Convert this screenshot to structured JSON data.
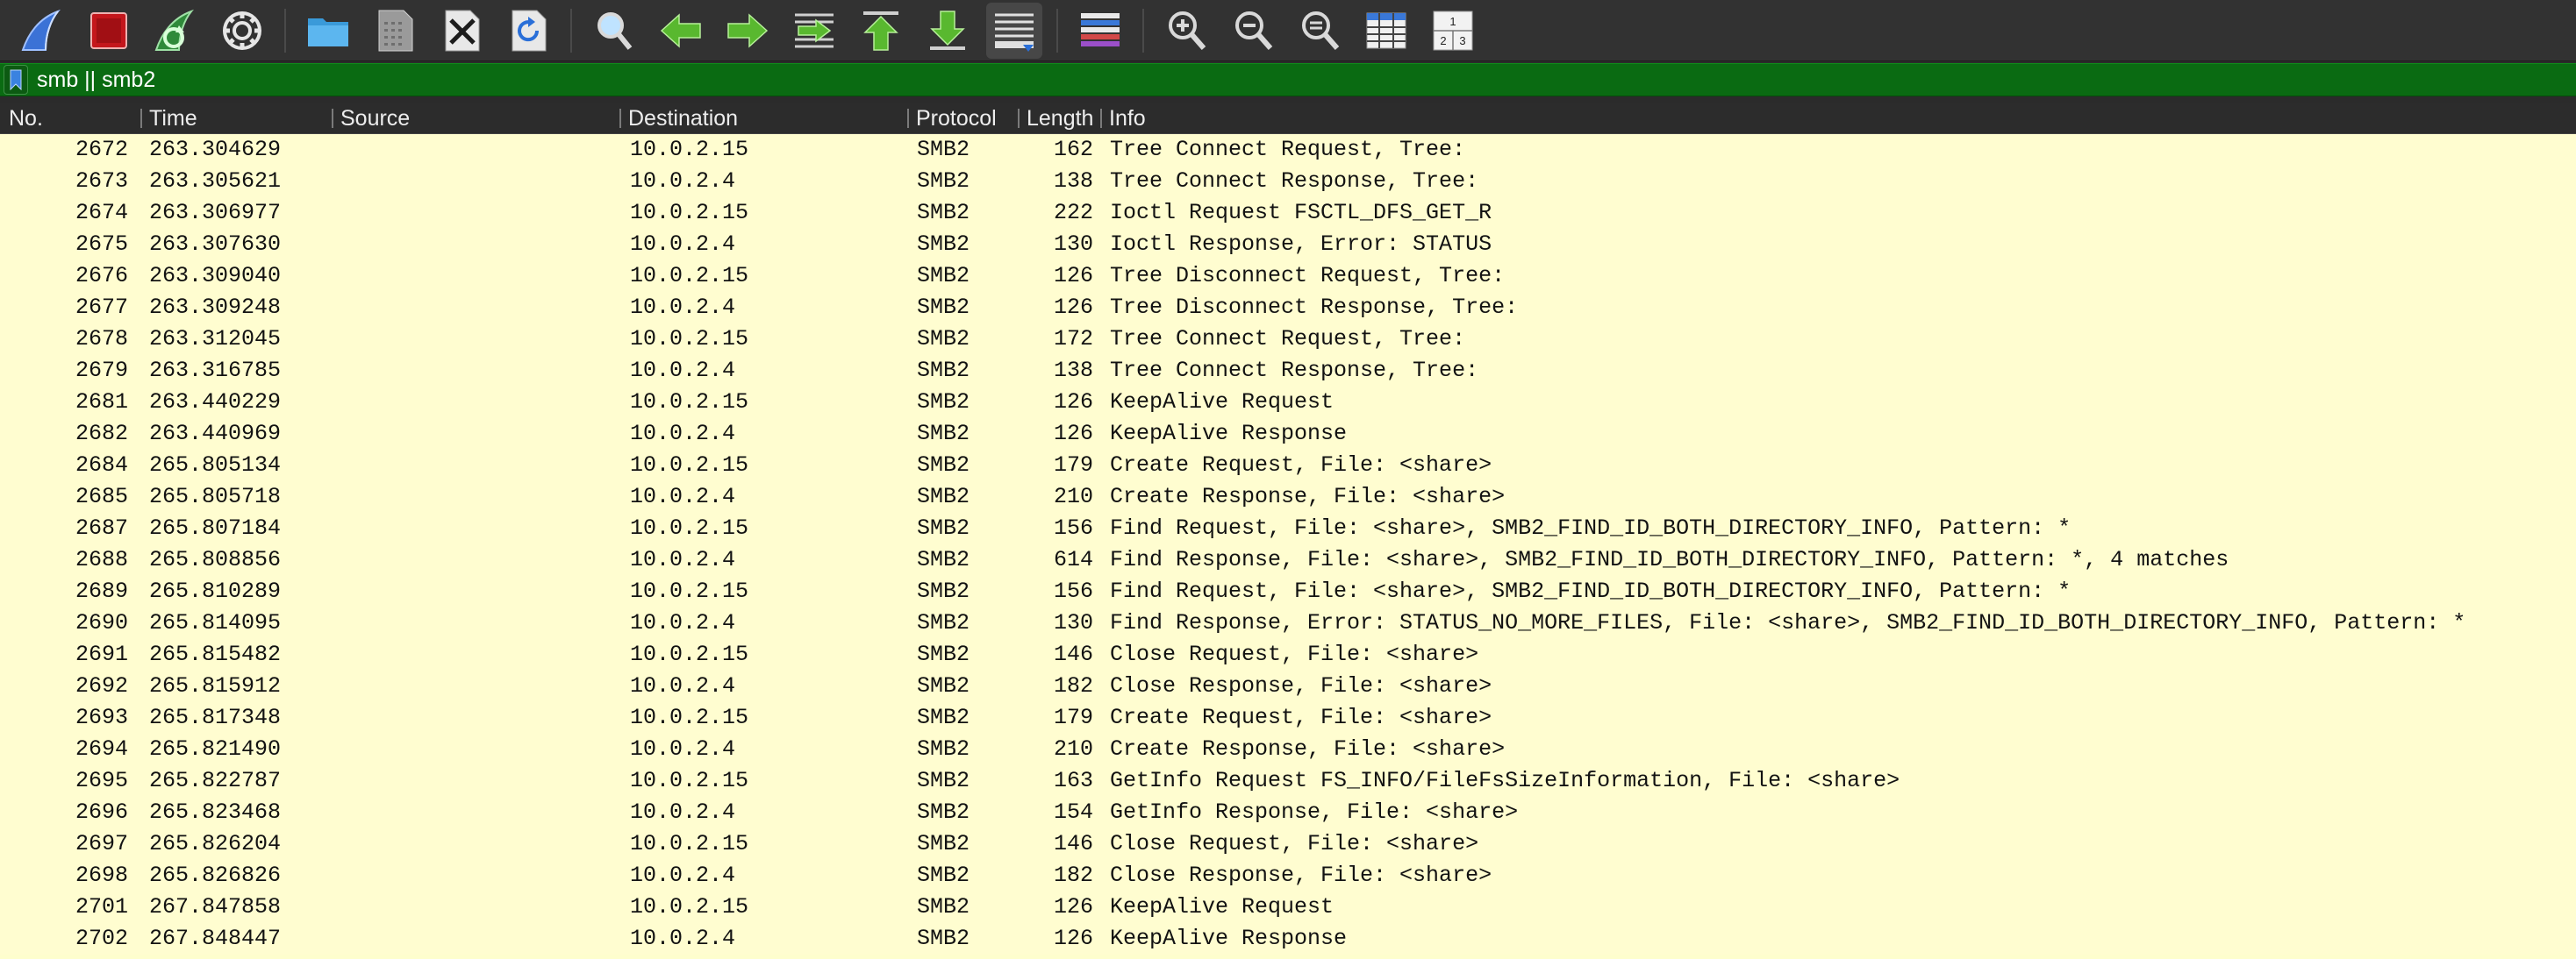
{
  "toolbar": {
    "buttons": [
      {
        "name": "start-capture-icon"
      },
      {
        "name": "stop-capture-icon"
      },
      {
        "name": "restart-capture-icon"
      },
      {
        "name": "capture-options-icon"
      },
      {
        "name": "open-file-icon"
      },
      {
        "name": "save-file-icon"
      },
      {
        "name": "close-file-icon"
      },
      {
        "name": "reload-file-icon"
      },
      {
        "name": "find-packet-icon"
      },
      {
        "name": "go-back-icon"
      },
      {
        "name": "go-forward-icon"
      },
      {
        "name": "go-to-packet-icon"
      },
      {
        "name": "go-first-packet-icon"
      },
      {
        "name": "go-last-packet-icon"
      },
      {
        "name": "auto-scroll-icon"
      },
      {
        "name": "colorize-icon"
      },
      {
        "name": "zoom-in-icon"
      },
      {
        "name": "zoom-out-icon"
      },
      {
        "name": "normal-size-icon"
      },
      {
        "name": "resize-columns-icon"
      },
      {
        "name": "layout-icon"
      }
    ],
    "layout_icon_digits": [
      "1",
      "2",
      "3"
    ]
  },
  "filter": {
    "value": "smb || smb2",
    "bookmark_icon": "bookmark-icon",
    "background_color": "#0a6b12"
  },
  "columns": {
    "no": "No.",
    "time": "Time",
    "source": "Source",
    "destination": "Destination",
    "protocol": "Protocol",
    "length": "Length",
    "info": "Info"
  },
  "colors": {
    "row_background": "#fffdd0",
    "header_background": "#2c2c2c"
  },
  "packets": [
    {
      "no": "2672",
      "time": "263.304629",
      "source": "",
      "destination": "10.0.2.15",
      "protocol": "SMB2",
      "length": "162",
      "info": "Tree Connect Request, Tree:"
    },
    {
      "no": "2673",
      "time": "263.305621",
      "source": "",
      "destination": "10.0.2.4",
      "protocol": "SMB2",
      "length": "138",
      "info": "Tree Connect Response, Tree:"
    },
    {
      "no": "2674",
      "time": "263.306977",
      "source": "",
      "destination": "10.0.2.15",
      "protocol": "SMB2",
      "length": "222",
      "info": "Ioctl Request FSCTL_DFS_GET_R"
    },
    {
      "no": "2675",
      "time": "263.307630",
      "source": "",
      "destination": "10.0.2.4",
      "protocol": "SMB2",
      "length": "130",
      "info": "Ioctl Response, Error: STATUS"
    },
    {
      "no": "2676",
      "time": "263.309040",
      "source": "",
      "destination": "10.0.2.15",
      "protocol": "SMB2",
      "length": "126",
      "info": "Tree Disconnect Request, Tree:"
    },
    {
      "no": "2677",
      "time": "263.309248",
      "source": "",
      "destination": "10.0.2.4",
      "protocol": "SMB2",
      "length": "126",
      "info": "Tree Disconnect Response, Tree:"
    },
    {
      "no": "2678",
      "time": "263.312045",
      "source": "",
      "destination": "10.0.2.15",
      "protocol": "SMB2",
      "length": "172",
      "info": "Tree Connect Request, Tree:"
    },
    {
      "no": "2679",
      "time": "263.316785",
      "source": "",
      "destination": "10.0.2.4",
      "protocol": "SMB2",
      "length": "138",
      "info": "Tree Connect Response, Tree:"
    },
    {
      "no": "2681",
      "time": "263.440229",
      "source": "",
      "destination": "10.0.2.15",
      "protocol": "SMB2",
      "length": "126",
      "info": "KeepAlive Request"
    },
    {
      "no": "2682",
      "time": "263.440969",
      "source": "",
      "destination": "10.0.2.4",
      "protocol": "SMB2",
      "length": "126",
      "info": "KeepAlive Response"
    },
    {
      "no": "2684",
      "time": "265.805134",
      "source": "",
      "destination": "10.0.2.15",
      "protocol": "SMB2",
      "length": "179",
      "info": "Create Request, File: <share>"
    },
    {
      "no": "2685",
      "time": "265.805718",
      "source": "",
      "destination": "10.0.2.4",
      "protocol": "SMB2",
      "length": "210",
      "info": "Create Response, File: <share>"
    },
    {
      "no": "2687",
      "time": "265.807184",
      "source": "",
      "destination": "10.0.2.15",
      "protocol": "SMB2",
      "length": "156",
      "info": "Find Request, File: <share>, SMB2_FIND_ID_BOTH_DIRECTORY_INFO, Pattern: *"
    },
    {
      "no": "2688",
      "time": "265.808856",
      "source": "",
      "destination": "10.0.2.4",
      "protocol": "SMB2",
      "length": "614",
      "info": "Find Response, File: <share>, SMB2_FIND_ID_BOTH_DIRECTORY_INFO, Pattern: *, 4 matches"
    },
    {
      "no": "2689",
      "time": "265.810289",
      "source": "",
      "destination": "10.0.2.15",
      "protocol": "SMB2",
      "length": "156",
      "info": "Find Request, File: <share>, SMB2_FIND_ID_BOTH_DIRECTORY_INFO, Pattern: *"
    },
    {
      "no": "2690",
      "time": "265.814095",
      "source": "",
      "destination": "10.0.2.4",
      "protocol": "SMB2",
      "length": "130",
      "info": "Find Response, Error: STATUS_NO_MORE_FILES, File: <share>, SMB2_FIND_ID_BOTH_DIRECTORY_INFO, Pattern: *"
    },
    {
      "no": "2691",
      "time": "265.815482",
      "source": "",
      "destination": "10.0.2.15",
      "protocol": "SMB2",
      "length": "146",
      "info": "Close Request, File: <share>"
    },
    {
      "no": "2692",
      "time": "265.815912",
      "source": "",
      "destination": "10.0.2.4",
      "protocol": "SMB2",
      "length": "182",
      "info": "Close Response, File: <share>"
    },
    {
      "no": "2693",
      "time": "265.817348",
      "source": "",
      "destination": "10.0.2.15",
      "protocol": "SMB2",
      "length": "179",
      "info": "Create Request, File: <share>"
    },
    {
      "no": "2694",
      "time": "265.821490",
      "source": "",
      "destination": "10.0.2.4",
      "protocol": "SMB2",
      "length": "210",
      "info": "Create Response, File: <share>"
    },
    {
      "no": "2695",
      "time": "265.822787",
      "source": "",
      "destination": "10.0.2.15",
      "protocol": "SMB2",
      "length": "163",
      "info": "GetInfo Request FS_INFO/FileFsSizeInformation, File: <share>"
    },
    {
      "no": "2696",
      "time": "265.823468",
      "source": "",
      "destination": "10.0.2.4",
      "protocol": "SMB2",
      "length": "154",
      "info": "GetInfo Response, File: <share>"
    },
    {
      "no": "2697",
      "time": "265.826204",
      "source": "",
      "destination": "10.0.2.15",
      "protocol": "SMB2",
      "length": "146",
      "info": "Close Request, File: <share>"
    },
    {
      "no": "2698",
      "time": "265.826826",
      "source": "",
      "destination": "10.0.2.4",
      "protocol": "SMB2",
      "length": "182",
      "info": "Close Response, File: <share>"
    },
    {
      "no": "2701",
      "time": "267.847858",
      "source": "",
      "destination": "10.0.2.15",
      "protocol": "SMB2",
      "length": "126",
      "info": "KeepAlive Request"
    },
    {
      "no": "2702",
      "time": "267.848447",
      "source": "",
      "destination": "10.0.2.4",
      "protocol": "SMB2",
      "length": "126",
      "info": "KeepAlive Response"
    }
  ]
}
